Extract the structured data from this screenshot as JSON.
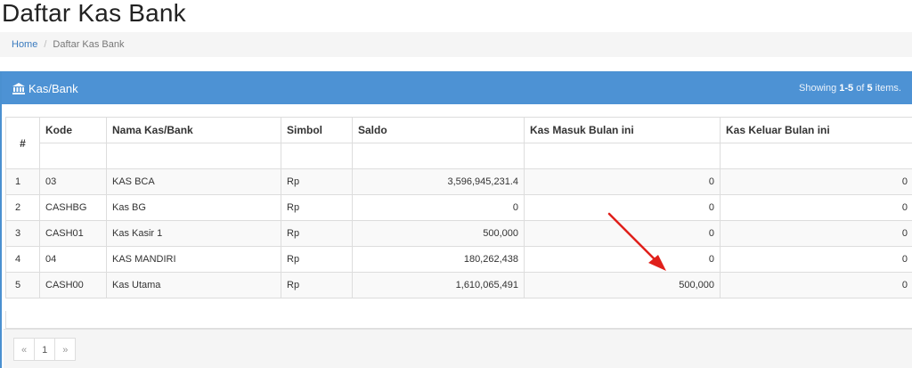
{
  "page": {
    "title": "Daftar Kas Bank"
  },
  "breadcrumb": {
    "home": "Home",
    "current": "Daftar Kas Bank"
  },
  "panel": {
    "title": "Kas/Bank",
    "icon": "bank-icon",
    "summary_prefix": "Showing ",
    "summary_range": "1-5",
    "summary_mid": " of ",
    "summary_total": "5",
    "summary_suffix": " items."
  },
  "table": {
    "columns": [
      "#",
      "Kode",
      "Nama Kas/Bank",
      "Simbol",
      "Saldo",
      "Kas Masuk Bulan ini",
      "Kas Keluar Bulan ini"
    ],
    "rows": [
      [
        "1",
        "03",
        "KAS BCA",
        "Rp",
        "3,596,945,231.4",
        "0",
        "0"
      ],
      [
        "2",
        "CASHBG",
        "Kas BG",
        "Rp",
        "0",
        "0",
        "0"
      ],
      [
        "3",
        "CASH01",
        "Kas Kasir 1",
        "Rp",
        "500,000",
        "0",
        "0"
      ],
      [
        "4",
        "04",
        "KAS MANDIRI",
        "Rp",
        "180,262,438",
        "0",
        "0"
      ],
      [
        "5",
        "CASH00",
        "Kas Utama",
        "Rp",
        "1,610,065,491",
        "500,000",
        "0"
      ]
    ]
  },
  "pagination": {
    "prev": "«",
    "page": "1",
    "next": "»"
  },
  "colors": {
    "panel_header": "#4d92d4",
    "arrow": "#e0201b",
    "link": "#3a7bbf"
  }
}
